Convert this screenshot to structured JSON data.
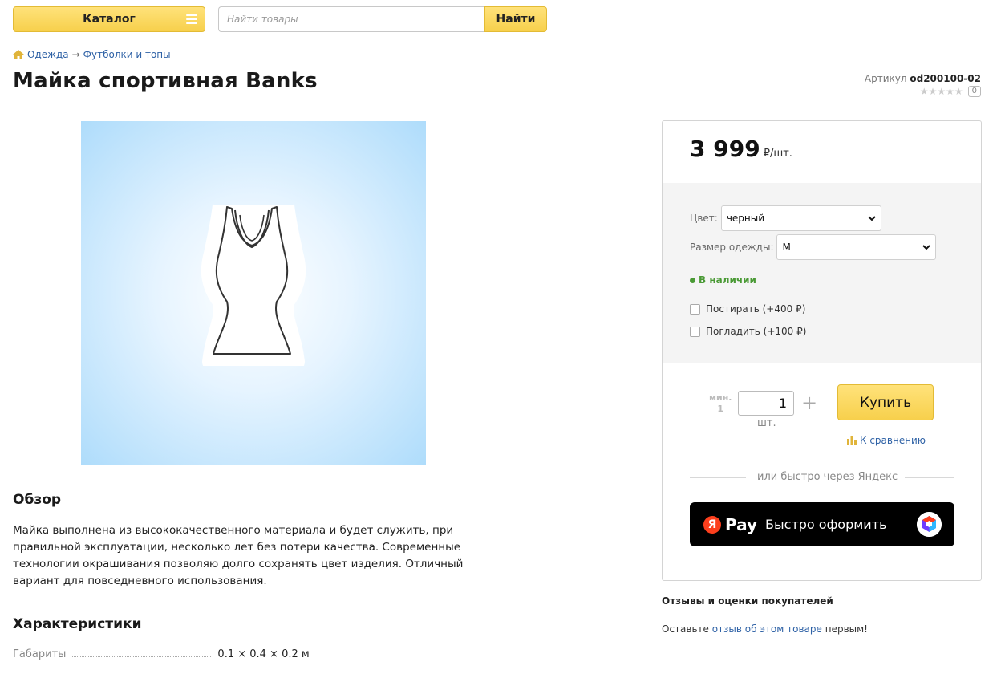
{
  "header": {
    "catalog_label": "Каталог",
    "search_placeholder": "Найти товары",
    "search_button": "Найти"
  },
  "breadcrumb": {
    "items": [
      "Одежда",
      "Футболки и топы"
    ],
    "separator": "→"
  },
  "product": {
    "title": "Майка спортивная Banks",
    "sku_label": "Артикул",
    "sku": "od200100-02",
    "rating_stars": "★★★★★",
    "review_count": "0"
  },
  "overview": {
    "heading": "Обзор",
    "text": "Майка выполнена из высококачественного материала и будет служить, при правильной эксплуатации, несколько лет без потери качества. Современные технологии окрашивания позволяю долго сохранять цвет изделия. Отличный вариант для повседневного использования."
  },
  "specs": {
    "heading": "Характеристики",
    "rows": [
      {
        "name": "Габариты",
        "value": "0.1 × 0.4 × 0.2 м"
      }
    ]
  },
  "buy": {
    "price": "3 999",
    "price_unit": "₽/шт.",
    "color_label": "Цвет:",
    "color_value": "черный",
    "size_label": "Размер одежды:",
    "size_value": "M",
    "stock": "В наличии",
    "services": [
      {
        "label": "Постирать (+400 ₽)",
        "checked": false
      },
      {
        "label": "Погладить (+100 ₽)",
        "checked": false
      }
    ],
    "min_label": "мин.",
    "min_value": "1",
    "quantity": "1",
    "qty_unit": "шт.",
    "plus": "+",
    "buy_button": "Купить",
    "compare_link": "К сравнению",
    "or_text": "или быстро через Яндекс",
    "ypay_logo": "Я",
    "ypay_word": "Pay",
    "ypay_label": "Быстро оформить"
  },
  "reviews": {
    "title": "Отзывы и оценки покупателей",
    "prefix": "Оставьте ",
    "link": "отзыв об этом товаре",
    "suffix": " первым!"
  },
  "colors": {
    "accent_yellow": "#f7d04c",
    "link_blue": "#2f62a6",
    "stock_green": "#4a9a35",
    "ya_red": "#fc3f1d"
  }
}
